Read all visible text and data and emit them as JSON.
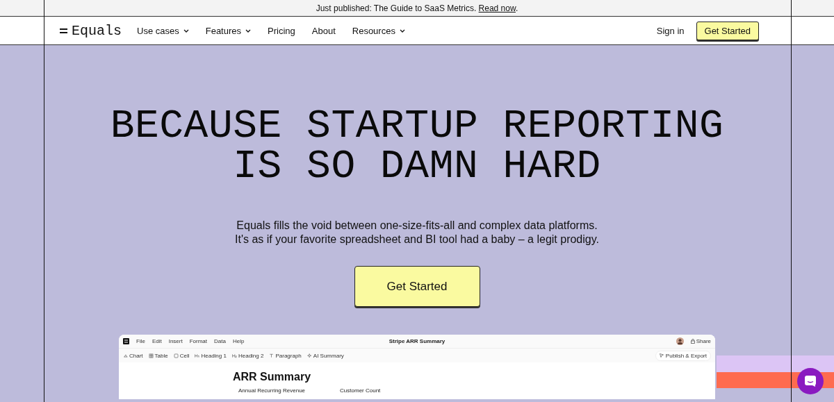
{
  "banner": {
    "text": "Just published: The Guide to SaaS Metrics.",
    "link": "Read now",
    "after": "."
  },
  "nav": {
    "logo": "Equals",
    "items": [
      {
        "label": "Use cases",
        "dropdown": true
      },
      {
        "label": "Features",
        "dropdown": true
      },
      {
        "label": "Pricing",
        "dropdown": false
      },
      {
        "label": "About",
        "dropdown": false
      },
      {
        "label": "Resources",
        "dropdown": true
      }
    ],
    "sign_in": "Sign in",
    "cta": "Get Started"
  },
  "hero": {
    "headline": [
      "BECAUSE STARTUP REPORTING",
      "IS SO DAMN HARD"
    ],
    "text": [
      "Equals fills the void between one-size-fits-all and complex data platforms.",
      "It's as if your favorite spreadsheet and BI tool had a baby – a legit prodigy."
    ],
    "cta": "Get Started"
  },
  "app": {
    "menu": [
      "File",
      "Edit",
      "Insert",
      "Format",
      "Data",
      "Help"
    ],
    "title": "Stripe ARR Summary",
    "share": "Share",
    "toolbar": [
      {
        "kind": "chart",
        "label": "Chart"
      },
      {
        "kind": "table",
        "label": "Table"
      },
      {
        "kind": "cell",
        "label": "Cell"
      },
      {
        "kind": "h1",
        "label": "Heading 1"
      },
      {
        "kind": "h2",
        "label": "Heading 2"
      },
      {
        "kind": "paragraph",
        "label": "Paragraph"
      },
      {
        "kind": "ai",
        "label": "AI Summary"
      }
    ],
    "publish": "Publish & Export",
    "doc_title": "ARR Summary",
    "columns": [
      "Annual Recurring Revenue",
      "Customer Count"
    ]
  }
}
